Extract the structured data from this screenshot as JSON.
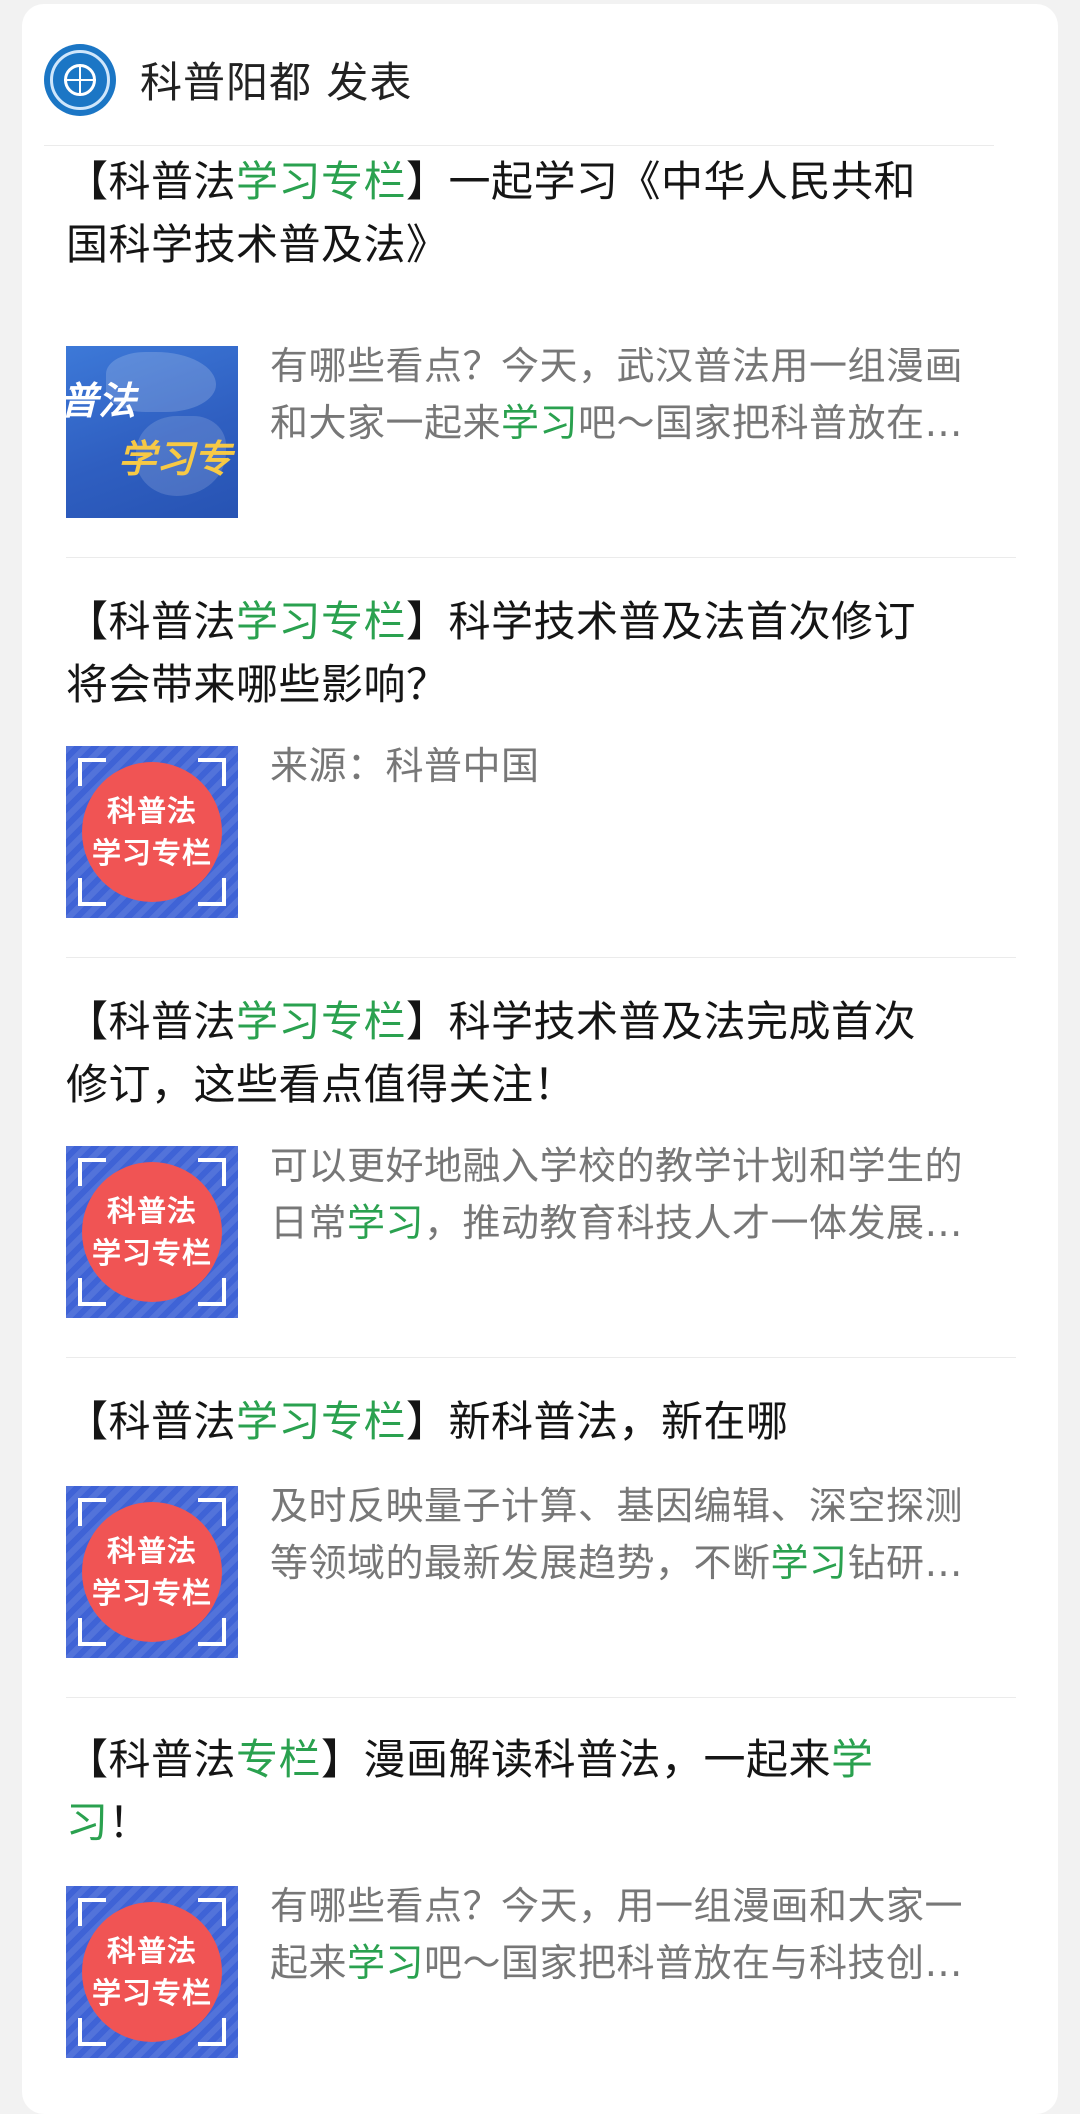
{
  "header": {
    "account_name": "科普阳都 发表",
    "logo_icon": "organization-logo-icon"
  },
  "accent_color": "#2aa14f",
  "articles": [
    {
      "title_parts": [
        "【科普法",
        "学习专栏",
        "】一起学习《中华人民共和",
        "国科学技术普及法》"
      ],
      "thumb_text": [
        "普法",
        "学习专"
      ],
      "desc_lines": [
        [
          "有哪些看点？今天，武汉普法用一组漫画"
        ],
        [
          "和大家一起来",
          "学习",
          "吧～国家把科普放在…"
        ]
      ]
    },
    {
      "title_parts": [
        "【科普法",
        "学习专栏",
        "】科学技术普及法首次修订",
        "将会带来哪些影响？"
      ],
      "thumb_text": [
        "科普法",
        "学习专栏"
      ],
      "desc_lines": [
        [
          "来源：科普中国"
        ]
      ]
    },
    {
      "title_parts": [
        "【科普法",
        "学习专栏",
        "】科学技术普及法完成首次",
        "修订，这些看点值得关注！"
      ],
      "thumb_text": [
        "科普法",
        "学习专栏"
      ],
      "desc_lines": [
        [
          "可以更好地融入学校的教学计划和学生的"
        ],
        [
          "日常",
          "学习",
          "，推动教育科技人才一体发展…"
        ]
      ]
    },
    {
      "title_parts": [
        "【科普法",
        "学习专栏",
        "】新科普法，新在哪"
      ],
      "thumb_text": [
        "科普法",
        "学习专栏"
      ],
      "desc_lines": [
        [
          "及时反映量子计算、基因编辑、深空探测"
        ],
        [
          "等领域的最新发展趋势，不断",
          "学习",
          "钻研…"
        ]
      ]
    },
    {
      "title_parts": [
        "【科普法",
        "专栏",
        "】漫画解读科普法，一起来",
        "学",
        "习",
        "！"
      ],
      "thumb_text": [
        "科普法",
        "学习专栏"
      ],
      "desc_lines": [
        [
          "有哪些看点？今天，用一组漫画和大家一"
        ],
        [
          "起来",
          "学习",
          "吧～国家把科普放在与科技创…"
        ]
      ]
    }
  ]
}
